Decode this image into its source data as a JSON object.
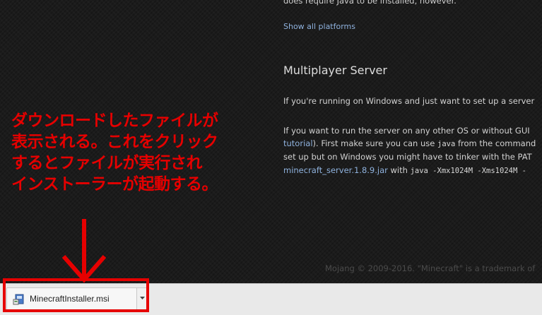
{
  "content": {
    "platform_note": "does require Java to be installed, however.",
    "show_all_platforms": "Show all platforms",
    "section_title": "Multiplayer Server",
    "windows_line": "If you're running on Windows and just want to set up a server",
    "os_line_1": "If you want to run the server on any other OS or without GUI",
    "tutorial_link": "tutorial",
    "os_line_2": "). First make sure you can use ",
    "java_code": "java",
    "os_line_2b": " from the command",
    "os_line_3": "set up but on Windows you might have to tinker with the PAT",
    "server_jar_link": "minecraft_server.1.8.9.jar",
    "with_text": " with ",
    "command_text": "java -Xmx1024M -Xms1024M -",
    "footer": "Mojang © 2009-2016. \"Minecraft\" is a trademark of"
  },
  "annotation": {
    "lines": [
      "ダウンロードしたファイルが",
      "表示される。これをクリック",
      "するとファイルが実行され",
      "インストーラーが起動する。"
    ],
    "color": "#e60000"
  },
  "download_bar": {
    "file_name": "MinecraftInstaller.msi",
    "icon": "msi-installer-icon",
    "dropdown_icon": "chevron-down-icon"
  }
}
